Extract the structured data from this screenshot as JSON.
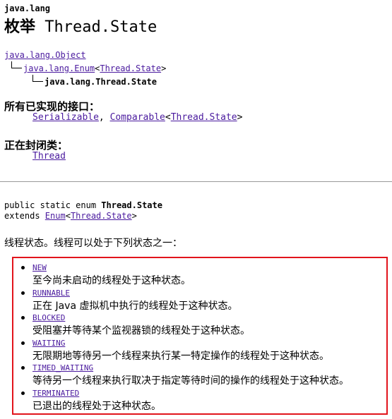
{
  "header": {
    "package": "java.lang",
    "title_kind": "枚举",
    "title_name": "Thread.State"
  },
  "hierarchy": {
    "root": "java.lang.Object",
    "mid_prefix": "java.lang.Enum",
    "mid_open": "<",
    "mid_param": "Thread.State",
    "mid_close": ">",
    "leaf": "java.lang.Thread.State"
  },
  "interfaces": {
    "heading": "所有已实现的接口：",
    "first": "Serializable",
    "sep": ", ",
    "second": "Comparable",
    "open": "<",
    "param": "Thread.State",
    "close": ">"
  },
  "enclosing": {
    "heading": "正在封闭类：",
    "link": "Thread"
  },
  "declaration": {
    "line1_prefix": "public static enum ",
    "line1_name": "Thread.State",
    "line2_prefix": "extends ",
    "line2_link": "Enum",
    "line2_open": "<",
    "line2_param": "Thread.State",
    "line2_close": ">"
  },
  "description": "线程状态。线程可以处于下列状态之一：",
  "states": [
    {
      "name": "NEW",
      "desc": "至今尚未启动的线程处于这种状态。"
    },
    {
      "name": "RUNNABLE",
      "desc": "正在 Java 虚拟机中执行的线程处于这种状态。"
    },
    {
      "name": "BLOCKED",
      "desc": "受阻塞并等待某个监视器锁的线程处于这种状态。"
    },
    {
      "name": "WAITING",
      "desc": "无限期地等待另一个线程来执行某一特定操作的线程处于这种状态。"
    },
    {
      "name": "TIMED_WAITING",
      "desc": "等待另一个线程来执行取决于指定等待时间的操作的线程处于这种状态。"
    },
    {
      "name": "TERMINATED",
      "desc": "已退出的线程处于这种状态。"
    }
  ],
  "colors": {
    "link": "#4a1a9e",
    "highlight_border": "#e2141c"
  }
}
